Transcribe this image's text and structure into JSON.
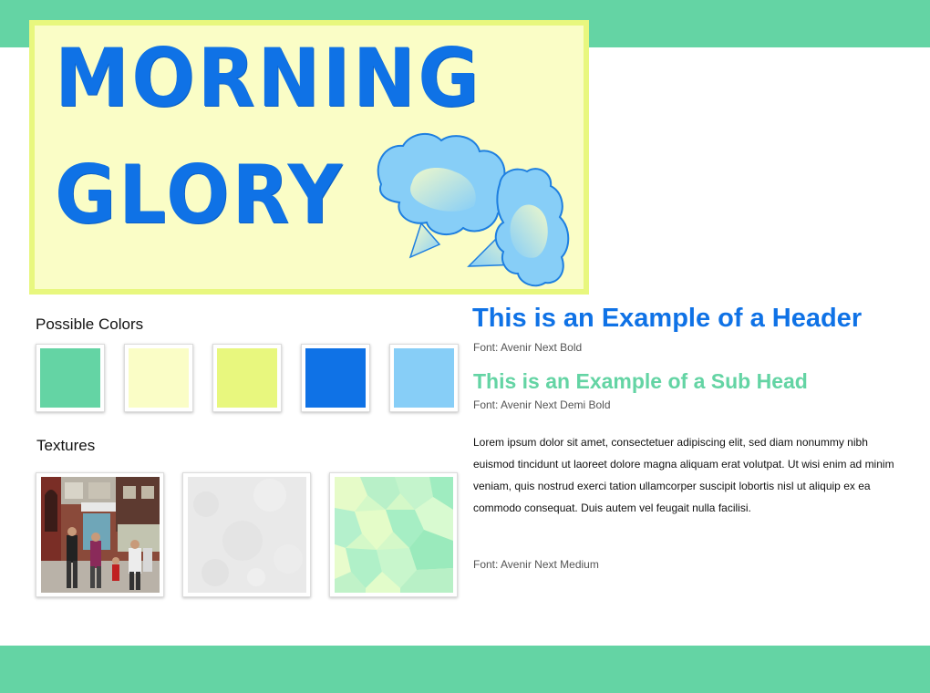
{
  "logo": {
    "line1": "MORNING",
    "line2": "GLORY",
    "flower_icon": "morning-glory-flower"
  },
  "palette": {
    "title": "Possible Colors",
    "swatches": [
      "#64d4a4",
      "#fafdc6",
      "#e8f77e",
      "#0f72e6",
      "#87cef7"
    ]
  },
  "textures": {
    "title": "Textures",
    "items": [
      "street-photo",
      "gray-paper",
      "green-hexagon-pattern"
    ]
  },
  "typography": {
    "header_example": "This is an Example of a Header",
    "header_font": "Font: Avenir Next Bold",
    "subhead_example": "This is an Example of a Sub Head",
    "subhead_font": "Font: Avenir Next Demi Bold",
    "body_example": "Lorem ipsum dolor sit amet, consectetuer adipiscing elit, sed diam nonummy nibh euismod tincidunt ut laoreet dolore magna aliquam erat volutpat. Ut wisi enim ad minim veniam, quis nostrud exerci tation ullamcorper suscipit lobortis nisl ut aliquip ex ea commodo consequat. Duis autem vel feugait nulla facilisi.",
    "body_font": "Font: Avenir Next Medium"
  }
}
